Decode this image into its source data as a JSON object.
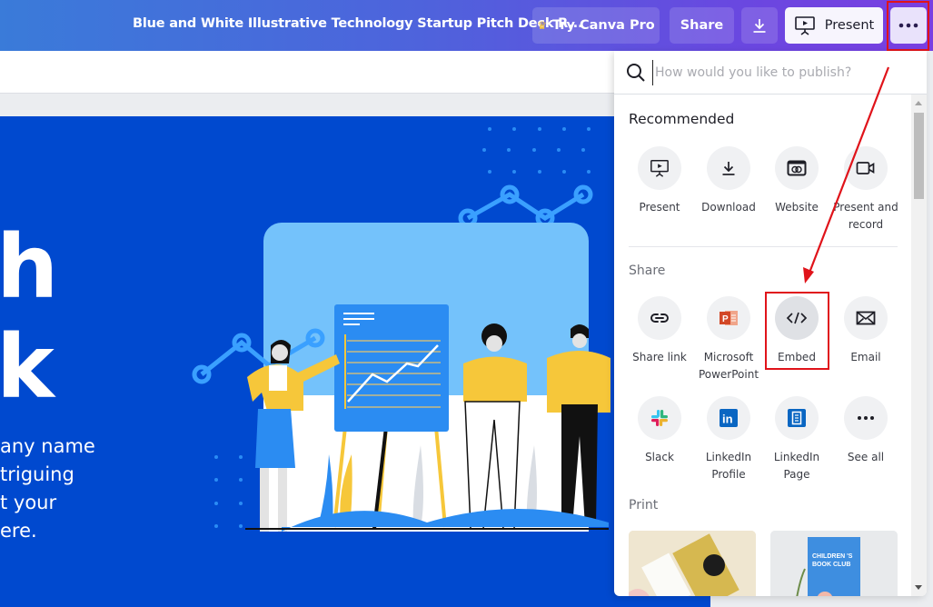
{
  "topbar": {
    "document_title": "Blue and White Illustrative Technology Startup Pitch Deck R...",
    "try_pro_label": "Try Canva Pro",
    "share_label": "Share",
    "download_icon": "download-icon",
    "present_label": "Present",
    "more_icon": "more-horizontal-icon"
  },
  "slide": {
    "title_fragment_1": "h",
    "title_fragment_2": "k",
    "body_text": "any name\ntriguing\nt your\nere."
  },
  "publish_panel": {
    "search_placeholder": "How would you like to publish?",
    "search_value": "",
    "recommended": {
      "title": "Recommended",
      "items": [
        {
          "label": "Present",
          "icon": "present-icon"
        },
        {
          "label": "Download",
          "icon": "download-icon"
        },
        {
          "label": "Website",
          "icon": "website-icon"
        },
        {
          "label": "Present and record",
          "icon": "video-camera-icon"
        }
      ]
    },
    "share": {
      "title": "Share",
      "items": [
        {
          "label": "Share link",
          "icon": "link-icon"
        },
        {
          "label": "Microsoft PowerPoint",
          "icon": "powerpoint-icon"
        },
        {
          "label": "Embed",
          "icon": "code-icon"
        },
        {
          "label": "Email",
          "icon": "email-icon"
        },
        {
          "label": "Slack",
          "icon": "slack-icon"
        },
        {
          "label": "LinkedIn Profile",
          "icon": "linkedin-icon"
        },
        {
          "label": "LinkedIn Page",
          "icon": "linkedin-page-icon"
        },
        {
          "label": "See all",
          "icon": "more-horizontal-icon"
        }
      ]
    },
    "print": {
      "title": "Print",
      "cards": [
        {
          "name": "business-cards-thumbnail"
        },
        {
          "name": "book-club-poster-thumbnail",
          "text": "CHILDREN 'S BOOK CLUB"
        }
      ]
    }
  },
  "colors": {
    "canvas_blue": "#0049cf",
    "highlight_red": "#e0131a",
    "topbar_start": "#3a7bd9",
    "topbar_end": "#7a3fe1"
  }
}
